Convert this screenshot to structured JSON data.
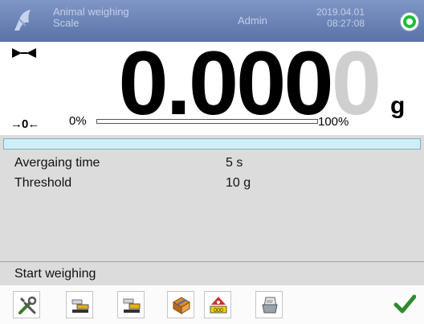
{
  "header": {
    "mode_line1": "Animal weighing",
    "mode_line2": "Scale",
    "user": "Admin",
    "date": "2019.04.01",
    "time": "08:27:08",
    "status_color": "#1fbd3a"
  },
  "display": {
    "stability_icon": "stability-marker-icon",
    "zero_marker": "→0←",
    "result_main": "0.000",
    "result_ghost": "0",
    "unit": "g",
    "bargraph_min": "0%",
    "bargraph_max": "100%",
    "bargraph_fill_fraction": 0
  },
  "info": {
    "averaging_label": "Avergaing time",
    "averaging_value": "5 s",
    "threshold_label": "Threshold",
    "threshold_value": "10 g"
  },
  "prompt": "Start weighing",
  "toolbar": {
    "buttons": [
      "tools-icon",
      "tare-icon",
      "set-tare-icon",
      "database-icon",
      "animal-scale-icon",
      "print-icon"
    ],
    "confirm_icon": "checkmark-icon",
    "accent": "#2e8b2e"
  }
}
